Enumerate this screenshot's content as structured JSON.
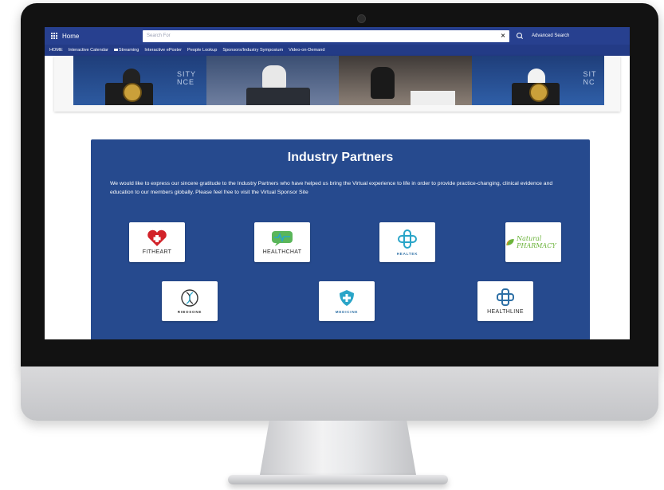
{
  "topbar": {
    "home_label": "Home",
    "search_placeholder": "Search For",
    "advanced_search": "Advanced Search"
  },
  "nav": {
    "items": [
      "HOME",
      "Interactive Calendar",
      "Streaming",
      "Interactive ePoster",
      "People Lookup",
      "Sponsors/Industry Symposium",
      "Video-on-Demand"
    ]
  },
  "partners": {
    "title": "Industry Partners",
    "text": "We would like to express our sincere gratitude to the Industry Partners who have helped us bring the Virtual experience to life in order to provide practice-changing, clinical evidence and education to our members globally. Please feel free to visit the Virtual Sponsor Site",
    "logos": [
      "FITHEART",
      "HEALTHCHAT",
      "HEALTEK",
      "Natural PHARMACY",
      "RIBOSONE",
      "MEDICINE",
      "HEALTHLINE"
    ]
  },
  "colors": {
    "header_blue": "#27408f",
    "panel_blue": "#264a8e",
    "fitheart_red": "#d2232a",
    "healthchat_green": "#5ab65a",
    "healtek_teal": "#2aa5c8"
  }
}
